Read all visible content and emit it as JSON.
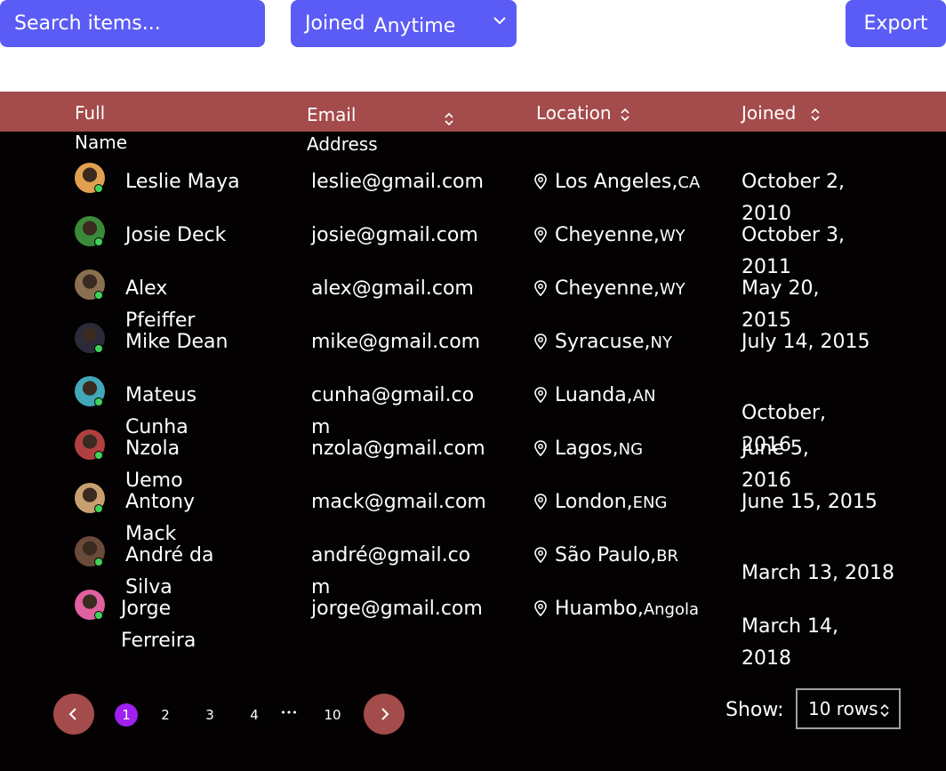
{
  "toolbar": {
    "search_placeholder": "Search items...",
    "filter_label": "Joined",
    "filter_value": "Anytime",
    "export_label": "Export"
  },
  "table": {
    "columns": [
      "Full Name",
      "Email Address",
      "Location",
      "Joined"
    ],
    "rows": [
      {
        "name": "Leslie Maya",
        "email": "leslie@gmail.com",
        "city": "Los Angeles,",
        "state": "CA",
        "joined": "October 2, 2010",
        "avatar_color": "#e0a050"
      },
      {
        "name": "Josie Deck",
        "email": "josie@gmail.com",
        "city": "Cheyenne,",
        "state": "WY",
        "joined": "October 3, 2011",
        "avatar_color": "#3a8a3a"
      },
      {
        "name": "Alex Pfeiffer",
        "email": "alex@gmail.com",
        "city": "Cheyenne,",
        "state": "WY",
        "joined": "May 20, 2015",
        "avatar_color": "#8a7050"
      },
      {
        "name": "Mike Dean",
        "email": "mike@gmail.com",
        "city": "Syracuse,",
        "state": "NY",
        "joined": "July 14, 2015",
        "avatar_color": "#2a2a3a"
      },
      {
        "name": "Mateus Cunha",
        "email": "cunha@gmail.com",
        "city": "Luanda,",
        "state": "AN",
        "joined": "October, 2016",
        "avatar_color": "#40a8b8"
      },
      {
        "name": "Nzola Uemo",
        "email": "nzola@gmail.com",
        "city": "Lagos,",
        "state": "NG",
        "joined": "June 5, 2016",
        "avatar_color": "#b04040"
      },
      {
        "name": "Antony Mack",
        "email": "mack@gmail.com",
        "city": "London,",
        "state": "ENG",
        "joined": "June 15, 2015",
        "avatar_color": "#c8a070"
      },
      {
        "name": "André da Silva",
        "email": "andré@gmail.com",
        "city": "São Paulo,",
        "state": "BR",
        "joined": "March 13, 2018",
        "avatar_color": "#6a4a3a"
      },
      {
        "name": "Jorge Ferreira",
        "email": "jorge@gmail.com",
        "city": "Huambo,",
        "state": "Angola",
        "joined": "March 14, 2018",
        "avatar_color": "#e060a0"
      }
    ]
  },
  "pagination": {
    "pages": [
      "1",
      "2",
      "3",
      "4",
      "10"
    ],
    "ellipsis": "•••",
    "current": "1",
    "show_label": "Show:",
    "rows_value": "10 rows"
  },
  "colors": {
    "accent": "#5b5cf6",
    "header": "#a44b4b",
    "table_bg": "#040102",
    "online": "#3fd35a",
    "active_page": "#a020f0"
  }
}
